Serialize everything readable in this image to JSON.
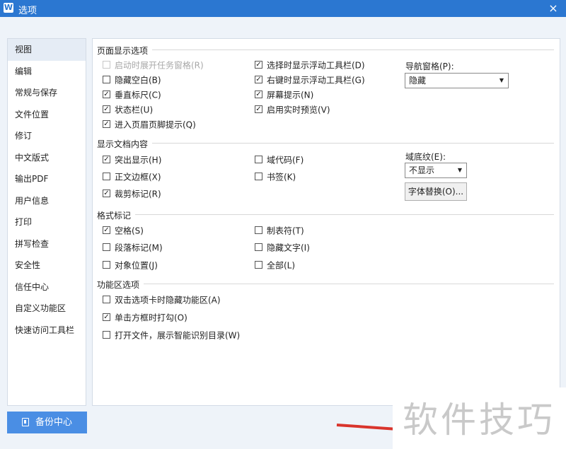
{
  "window": {
    "title": "选项",
    "app_icon_letter": "W",
    "close_symbol": "×"
  },
  "sidebar": {
    "items": [
      {
        "label": "视图",
        "active": true
      },
      {
        "label": "编辑"
      },
      {
        "label": "常规与保存"
      },
      {
        "label": "文件位置"
      },
      {
        "label": "修订"
      },
      {
        "label": "中文版式"
      },
      {
        "label": "输出PDF"
      },
      {
        "label": "用户信息"
      },
      {
        "label": "打印"
      },
      {
        "label": "拼写检查"
      },
      {
        "label": "安全性"
      },
      {
        "label": "信任中心"
      },
      {
        "label": "自定义功能区"
      },
      {
        "label": "快速访问工具栏"
      }
    ],
    "backup_label": "备份中心"
  },
  "page_display": {
    "title": "页面显示选项",
    "options": [
      {
        "label": "启动时展开任务窗格(R)",
        "checked": false,
        "disabled": true
      },
      {
        "label": "隐藏空白(B)",
        "checked": false
      },
      {
        "label": "垂直标尺(C)",
        "checked": true
      },
      {
        "label": "状态栏(U)",
        "checked": true
      },
      {
        "label": "进入页眉页脚提示(Q)",
        "checked": true
      },
      {
        "label": "选择时显示浮动工具栏(D)",
        "checked": true
      },
      {
        "label": "右键时显示浮动工具栏(G)",
        "checked": true
      },
      {
        "label": "屏幕提示(N)",
        "checked": true
      },
      {
        "label": "启用实时预览(V)",
        "checked": true
      }
    ],
    "nav_pane_label": "导航窗格(P):",
    "nav_pane_value": "隐藏"
  },
  "doc_content": {
    "title": "显示文档内容",
    "options": [
      {
        "label": "突出显示(H)",
        "checked": true
      },
      {
        "label": "正文边框(X)",
        "checked": false
      },
      {
        "label": "裁剪标记(R)",
        "checked": true
      },
      {
        "label": "域代码(F)",
        "checked": false
      },
      {
        "label": "书签(K)",
        "checked": false
      }
    ],
    "field_shading_label": "域底纹(E):",
    "field_shading_value": "不显示",
    "font_sub_button": "字体替换(O)..."
  },
  "format_marks": {
    "title": "格式标记",
    "options": [
      {
        "label": "空格(S)",
        "checked": true
      },
      {
        "label": "段落标记(M)",
        "checked": false
      },
      {
        "label": "对象位置(J)",
        "checked": false
      },
      {
        "label": "制表符(T)",
        "checked": false
      },
      {
        "label": "隐藏文字(I)",
        "checked": false
      },
      {
        "label": "全部(L)",
        "checked": false
      }
    ]
  },
  "ribbon": {
    "title": "功能区选项",
    "options": [
      {
        "label": "双击选项卡时隐藏功能区(A)",
        "checked": false
      },
      {
        "label": "单击方框时打勾(O)",
        "checked": true
      },
      {
        "label": "打开文件，展示智能识别目录(W)",
        "checked": false
      }
    ]
  },
  "watermark": "软件技巧",
  "colors": {
    "titlebar": "#2b77d1",
    "accent_button": "#4a8ee4",
    "annotation_arrow": "#d9342c"
  }
}
